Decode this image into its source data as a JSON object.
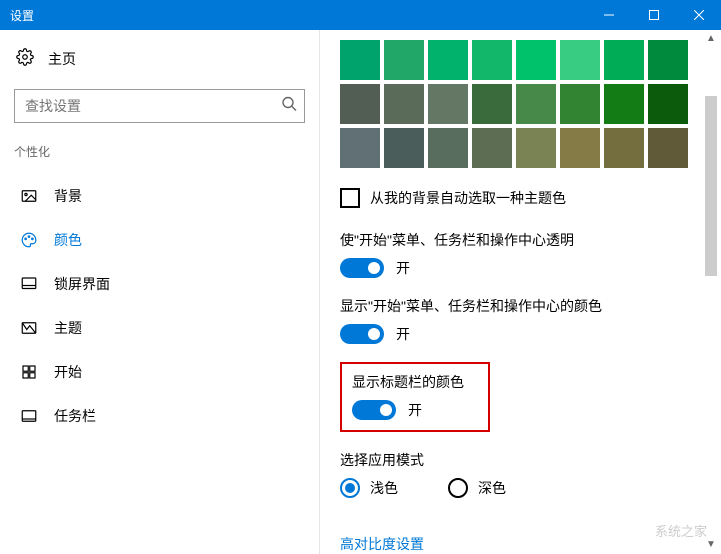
{
  "titlebar": {
    "title": "设置"
  },
  "home": {
    "label": "主页"
  },
  "search": {
    "placeholder": "查找设置"
  },
  "section": {
    "label": "个性化"
  },
  "nav": [
    {
      "label": "背景"
    },
    {
      "label": "颜色"
    },
    {
      "label": "锁屏界面"
    },
    {
      "label": "主题"
    },
    {
      "label": "开始"
    },
    {
      "label": "任务栏"
    }
  ],
  "swatches": {
    "row1": [
      "#00a36c",
      "#21a768",
      "#00b26b",
      "#13b76a",
      "#00c26a",
      "#38cc82",
      "#00ac55",
      "#008a3d"
    ],
    "row2": [
      "#525e54",
      "#5b6b5a",
      "#647764",
      "#3a6b3d",
      "#478949",
      "#328332",
      "#137c14",
      "#0c5a0c"
    ],
    "row3": [
      "#617074",
      "#4b5d5a",
      "#596d5e",
      "#5c6d54",
      "#7a8353",
      "#847b46",
      "#746d3d",
      "#605a38"
    ]
  },
  "autoPick": {
    "label": "从我的背景自动选取一种主题色",
    "checked": false
  },
  "transparent": {
    "label": "使\"开始\"菜单、任务栏和操作中心透明",
    "state": "开"
  },
  "showColorTaskbar": {
    "label": "显示\"开始\"菜单、任务栏和操作中心的颜色",
    "state": "开"
  },
  "showTitlebarColor": {
    "label": "显示标题栏的颜色",
    "state": "开"
  },
  "appMode": {
    "label": "选择应用模式",
    "light": "浅色",
    "dark": "深色",
    "selected": "light"
  },
  "highContrast": {
    "label": "高对比度设置"
  },
  "watermark": {
    "text": "系统之家"
  }
}
